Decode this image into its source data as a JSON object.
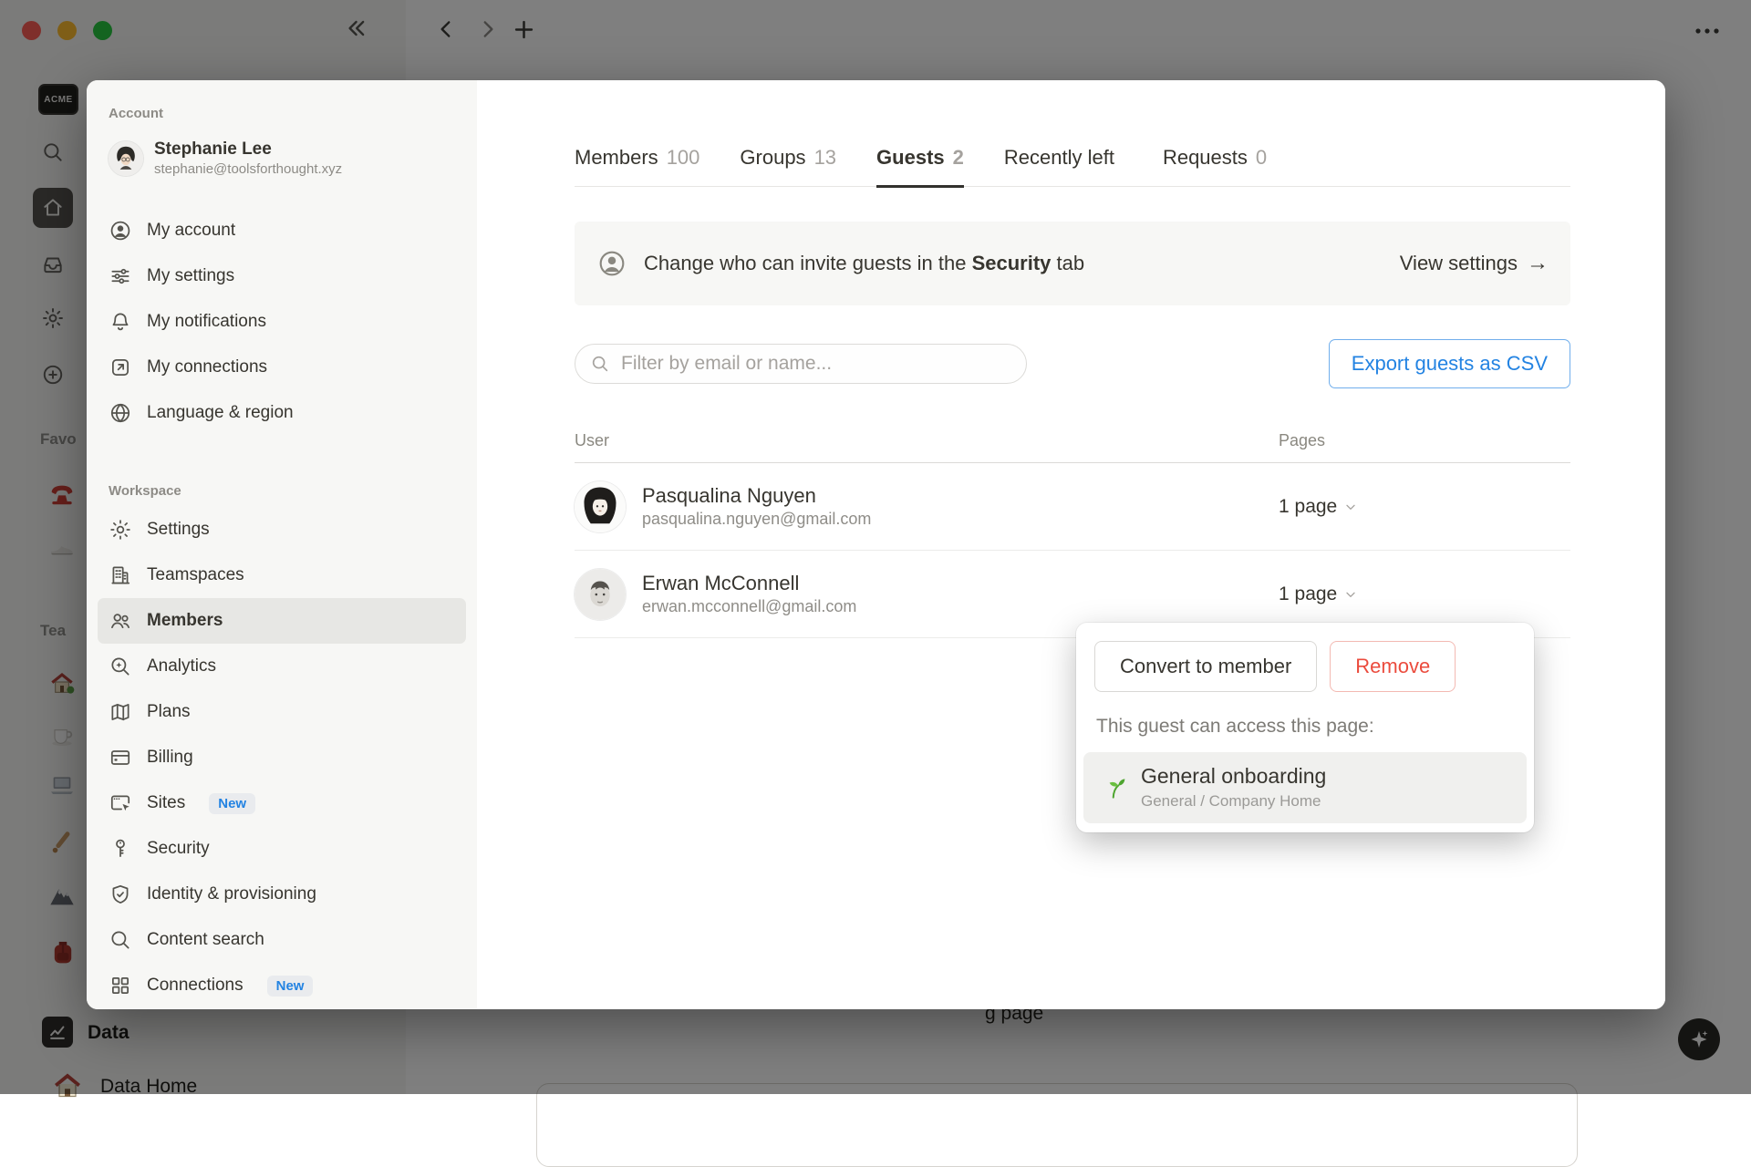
{
  "app_background": {
    "logo_text": "ACME",
    "favorites_label": "Favo",
    "teamspaces_label": "Tea",
    "data_label": "Data",
    "data_home_label": "Data Home",
    "page_fragment": "g page"
  },
  "dialog": {
    "sidebar": {
      "account_header": "Account",
      "user": {
        "name": "Stephanie Lee",
        "email": "stephanie@toolsforthought.xyz"
      },
      "account_items": [
        {
          "label": "My account"
        },
        {
          "label": "My settings"
        },
        {
          "label": "My notifications"
        },
        {
          "label": "My connections"
        },
        {
          "label": "Language & region"
        }
      ],
      "workspace_header": "Workspace",
      "workspace_items": [
        {
          "label": "Settings"
        },
        {
          "label": "Teamspaces"
        },
        {
          "label": "Members"
        },
        {
          "label": "Analytics"
        },
        {
          "label": "Plans"
        },
        {
          "label": "Billing"
        },
        {
          "label": "Sites",
          "badge": "New"
        },
        {
          "label": "Security"
        },
        {
          "label": "Identity & provisioning"
        },
        {
          "label": "Content search"
        },
        {
          "label": "Connections",
          "badge": "New"
        }
      ]
    },
    "main": {
      "tabs": [
        {
          "label": "Members",
          "count": "100"
        },
        {
          "label": "Groups",
          "count": "13"
        },
        {
          "label": "Guests",
          "count": "2"
        },
        {
          "label": "Recently left",
          "count": ""
        },
        {
          "label": "Requests",
          "count": "0"
        }
      ],
      "banner": {
        "text_before": "Change who can invite guests in the ",
        "bold": "Security",
        "text_after": " tab",
        "action_label": "View settings",
        "action_arrow": "→"
      },
      "filter_placeholder": "Filter by email or name...",
      "export_label": "Export guests as CSV",
      "table": {
        "col_user": "User",
        "col_pages": "Pages",
        "rows": [
          {
            "name": "Pasqualina Nguyen",
            "email": "pasqualina.nguyen@gmail.com",
            "pages": "1 page"
          },
          {
            "name": "Erwan McConnell",
            "email": "erwan.mcconnell@gmail.com",
            "pages": "1 page"
          }
        ]
      },
      "popup": {
        "convert_label": "Convert to member",
        "remove_label": "Remove",
        "caption": "This guest can access this page:",
        "page_title": "General onboarding",
        "page_path": "General / Company Home"
      }
    }
  },
  "colors": {
    "accent_blue": "#2383e2",
    "danger_red": "#eb4b3d",
    "seedling_green": "#52a53a",
    "traffic_red": "#ff5f57",
    "traffic_yellow": "#febc2e",
    "traffic_green": "#28c840"
  }
}
